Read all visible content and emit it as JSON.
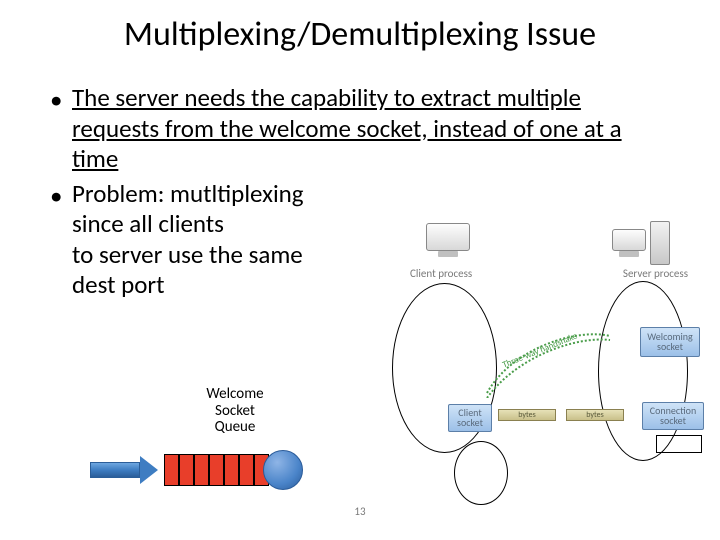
{
  "title": "Multiplexing/Demultiplexing Issue",
  "bullets": {
    "b1": "The server needs the capability to extract multiple requests from the welcome socket, instead of one at a time",
    "b2_l1": "Problem: mutltiplexing",
    "b2_l2": "since all clients",
    "b2_l3": "to server use the same",
    "b2_l4": "dest port"
  },
  "queue": {
    "label_l1": "Welcome",
    "label_l2": "Socket",
    "label_l3": "Queue"
  },
  "diagram": {
    "client_process": "Client process",
    "server_process": "Server process",
    "welcoming_socket": "Welcoming socket",
    "client_socket": "Client socket",
    "connection_socket": "Connection socket",
    "bytes1": "bytes",
    "bytes2": "bytes",
    "handshake": "Three-way handshake"
  },
  "page_number": "13"
}
